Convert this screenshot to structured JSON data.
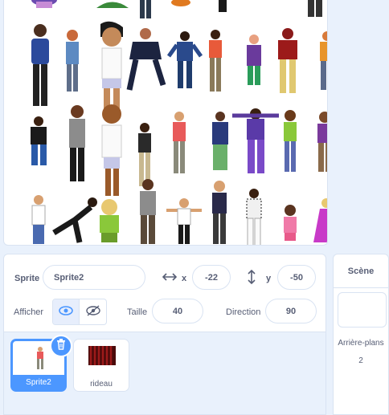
{
  "sprite_info": {
    "sprite_label": "Sprite",
    "sprite_name": "Sprite2",
    "x_label": "x",
    "x_value": "-22",
    "y_label": "y",
    "y_value": "-50",
    "show_label": "Afficher",
    "size_label": "Taille",
    "size_value": "40",
    "direction_label": "Direction",
    "direction_value": "90"
  },
  "sprite_list": [
    {
      "name": "Sprite2",
      "selected": true
    },
    {
      "name": "rideau",
      "selected": false
    }
  ],
  "stage_panel": {
    "title": "Scène",
    "backdrops_label": "Arrière-plans",
    "backdrops_count": "2"
  },
  "colors": {
    "accent": "#4c97ff",
    "text": "#575e75",
    "panel_bg": "#e9f1fc"
  },
  "icons": [
    "eye-icon",
    "eye-slash-icon",
    "horizontal-arrows-icon",
    "vertical-arrows-icon",
    "trash-icon"
  ]
}
